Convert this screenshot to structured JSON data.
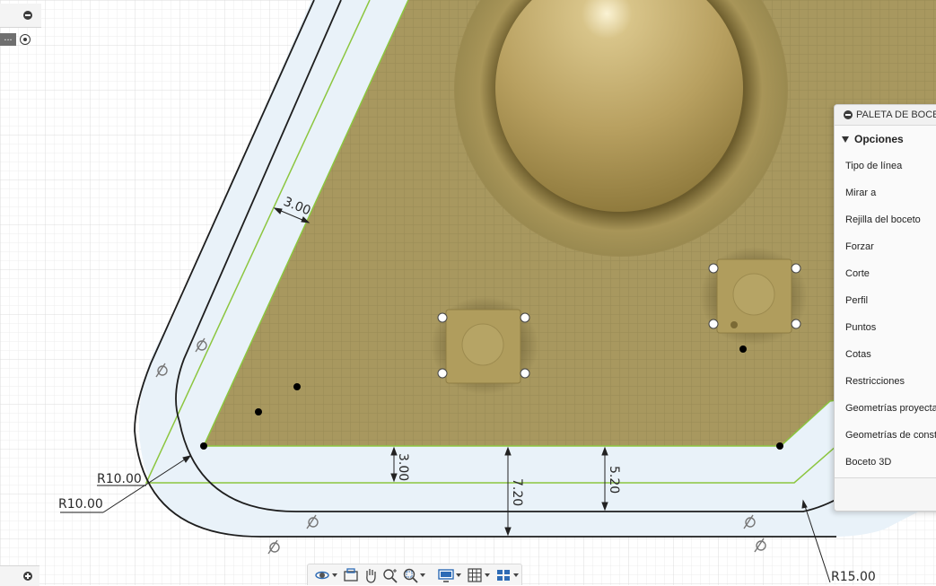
{
  "dimensions": {
    "wall_top": "3.00",
    "r_inner": "R10.00",
    "r_outer": "R10.00",
    "bottom_wall": "3.00",
    "height_center": "7.20",
    "height_right": "5.20",
    "r_large": "R15.00"
  },
  "palette": {
    "title": "PALETA DE BOCETO",
    "section": "Opciones",
    "options": [
      "Tipo de línea",
      "Mirar a",
      "Rejilla del boceto",
      "Forzar",
      "Corte",
      "Perfil",
      "Puntos",
      "Cotas",
      "Restricciones",
      "Geometrías proyectadas",
      "Geometrías de construcción",
      "Boceto 3D"
    ]
  },
  "browser": {
    "ellipsis": "..."
  },
  "colors": {
    "board": "#a8985f",
    "profile_fill": "#e8f1f8",
    "constraint_line": "#8cc63f",
    "sketch_line": "#1e1e1e",
    "grid": "#e3e3e3"
  },
  "nav_toolbar": {
    "icons": [
      "orbit-icon",
      "look-at-icon",
      "pan-icon",
      "zoom-icon",
      "fit-icon",
      "display-settings-icon",
      "grid-settings-icon",
      "viewports-icon"
    ]
  }
}
